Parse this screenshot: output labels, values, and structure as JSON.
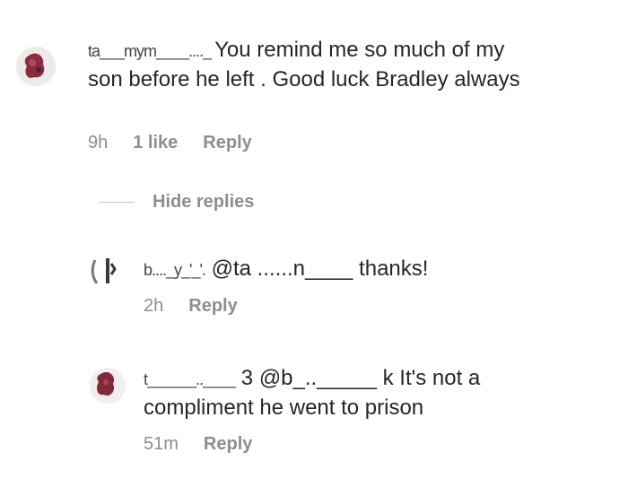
{
  "comment1": {
    "username": "ta___mym____...._ ",
    "text": "You remind me so much of my son before he left . Good luck Bradley always",
    "time": "9h",
    "likes": "1 like",
    "reply_label": "Reply"
  },
  "hide_replies_label": "Hide replies",
  "reply1": {
    "username": "b...._y_'_'.",
    "mention": "@ta ......n____",
    "text": " thanks!",
    "time": "2h",
    "reply_label": "Reply"
  },
  "reply2": {
    "username": "t______..____",
    "mention": "3 @b_.._____ k",
    "text": " It's not a compliment he went to prison",
    "time": "51m",
    "reply_label": "Reply"
  }
}
